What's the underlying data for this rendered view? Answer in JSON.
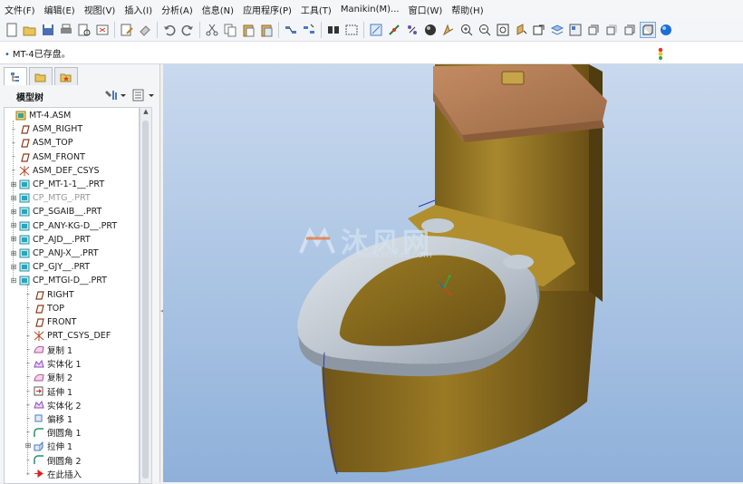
{
  "menu": [
    "文件(F)",
    "编辑(E)",
    "视图(V)",
    "插入(I)",
    "分析(A)",
    "信息(N)",
    "应用程序(P)",
    "工具(T)",
    "Manikin(M)...",
    "窗口(W)",
    "帮助(H)"
  ],
  "toolbar_icons": [
    "new-icon",
    "open-icon",
    "save-icon",
    "print-icon",
    "print-preview-icon",
    "close-window-icon",
    "edit-icon",
    "erase-icon",
    "undo-icon",
    "redo-icon",
    "cut-icon",
    "copy-icon",
    "paste-icon",
    "paste-special-icon",
    "regenerate-icon",
    "regenerate-manager-icon",
    "find-icon",
    "select-box-icon",
    "repaint-icon",
    "spin-center-icon",
    "datum-display-icon",
    "shading-icon",
    "orient-icon",
    "zoom-in-icon",
    "zoom-out-icon",
    "refit-icon",
    "reorient-icon",
    "view-manager-icon",
    "layers-icon",
    "appearance-icon",
    "wireframe-icon",
    "hidden-line-icon",
    "no-hidden-icon",
    "shaded-icon",
    "sphere-icon"
  ],
  "message": "MT-4已存盘。",
  "model_tree": {
    "title": "模型树",
    "items": [
      {
        "label": "MT-4.ASM",
        "icon": "assembly-icon",
        "level": 0,
        "expand": ""
      },
      {
        "label": "ASM_RIGHT",
        "icon": "datum-plane-icon",
        "level": 1,
        "expand": ""
      },
      {
        "label": "ASM_TOP",
        "icon": "datum-plane-icon",
        "level": 1,
        "expand": ""
      },
      {
        "label": "ASM_FRONT",
        "icon": "datum-plane-icon",
        "level": 1,
        "expand": ""
      },
      {
        "label": "ASM_DEF_CSYS",
        "icon": "csys-icon",
        "level": 1,
        "expand": ""
      },
      {
        "label": "CP_MT-1-1__.PRT",
        "icon": "part-icon",
        "level": 1,
        "expand": "+"
      },
      {
        "label": "CP_MTG_.PRT",
        "icon": "part-icon",
        "level": 1,
        "expand": "+",
        "dim": true
      },
      {
        "label": "CP_SGAIB__.PRT",
        "icon": "part-icon",
        "level": 1,
        "expand": "+"
      },
      {
        "label": "CP_ANY-KG-D__.PRT",
        "icon": "part-icon",
        "level": 1,
        "expand": "+"
      },
      {
        "label": "CP_AJD__.PRT",
        "icon": "part-icon",
        "level": 1,
        "expand": "+"
      },
      {
        "label": "CP_ANJ-X__.PRT",
        "icon": "part-icon",
        "level": 1,
        "expand": "+"
      },
      {
        "label": "CP_GJY__.PRT",
        "icon": "part-icon",
        "level": 1,
        "expand": "+"
      },
      {
        "label": "CP_MTGI-D__.PRT",
        "icon": "part-icon",
        "level": 1,
        "expand": "-"
      },
      {
        "label": "RIGHT",
        "icon": "datum-plane-icon",
        "level": 2,
        "expand": ""
      },
      {
        "label": "TOP",
        "icon": "datum-plane-icon",
        "level": 2,
        "expand": ""
      },
      {
        "label": "FRONT",
        "icon": "datum-plane-icon",
        "level": 2,
        "expand": ""
      },
      {
        "label": "PRT_CSYS_DEF",
        "icon": "csys-icon",
        "level": 2,
        "expand": ""
      },
      {
        "label": "复制 1",
        "icon": "copy-surface-icon",
        "level": 2,
        "expand": ""
      },
      {
        "label": "实体化 1",
        "icon": "solidify-icon",
        "level": 2,
        "expand": ""
      },
      {
        "label": "复制 2",
        "icon": "copy-surface-icon",
        "level": 2,
        "expand": ""
      },
      {
        "label": "延伸 1",
        "icon": "extend-icon",
        "level": 2,
        "expand": ""
      },
      {
        "label": "实体化 2",
        "icon": "solidify-icon",
        "level": 2,
        "expand": ""
      },
      {
        "label": "偏移 1",
        "icon": "offset-icon",
        "level": 2,
        "expand": ""
      },
      {
        "label": "倒圆角 1",
        "icon": "round-icon",
        "level": 2,
        "expand": ""
      },
      {
        "label": "拉伸 1",
        "icon": "extrude-icon",
        "level": 2,
        "expand": "+"
      },
      {
        "label": "倒圆角 2",
        "icon": "round-icon",
        "level": 2,
        "expand": ""
      },
      {
        "label": "在此插入",
        "icon": "insert-here-icon",
        "level": 2,
        "expand": ""
      }
    ]
  },
  "watermark": {
    "text": "沐风网",
    "url": "www.mfcad.com"
  },
  "colors": {
    "body": "#8a6e1f",
    "tank_lid": "#b07a52",
    "seat": "#b9c2cc",
    "background": "#a9c3e3"
  }
}
